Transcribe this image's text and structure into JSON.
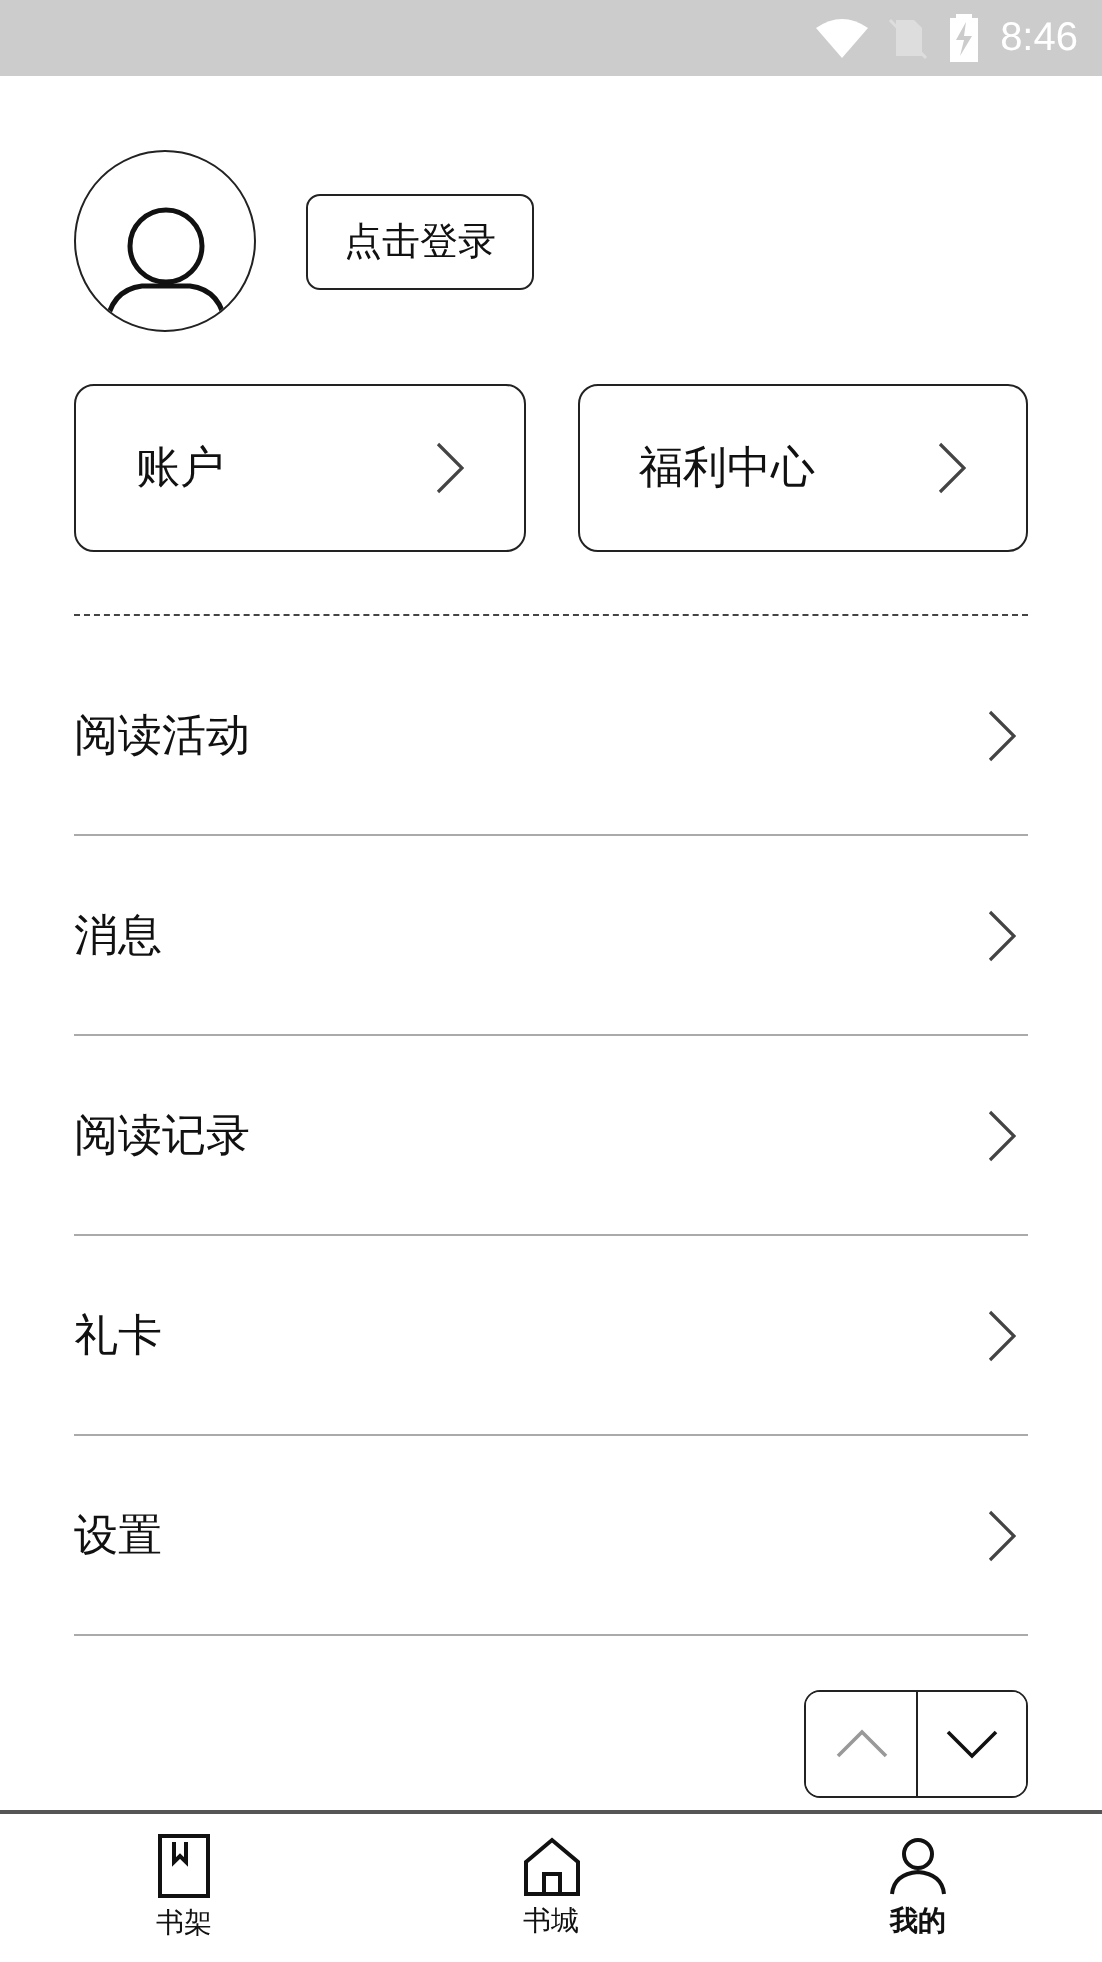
{
  "status_bar": {
    "time": "8:46"
  },
  "profile": {
    "login_button": "点击登录"
  },
  "cards": [
    {
      "label": "账户"
    },
    {
      "label": "福利中心"
    }
  ],
  "menu": [
    {
      "label": "阅读活动"
    },
    {
      "label": "消息"
    },
    {
      "label": "阅读记录"
    },
    {
      "label": "礼卡"
    },
    {
      "label": "设置"
    }
  ],
  "pager": {
    "up_disabled": true,
    "down_disabled": false
  },
  "tabs": [
    {
      "label": "书架",
      "kind": "book",
      "selected": false
    },
    {
      "label": "书城",
      "kind": "home",
      "selected": false
    },
    {
      "label": "我的",
      "kind": "person",
      "selected": true
    }
  ]
}
